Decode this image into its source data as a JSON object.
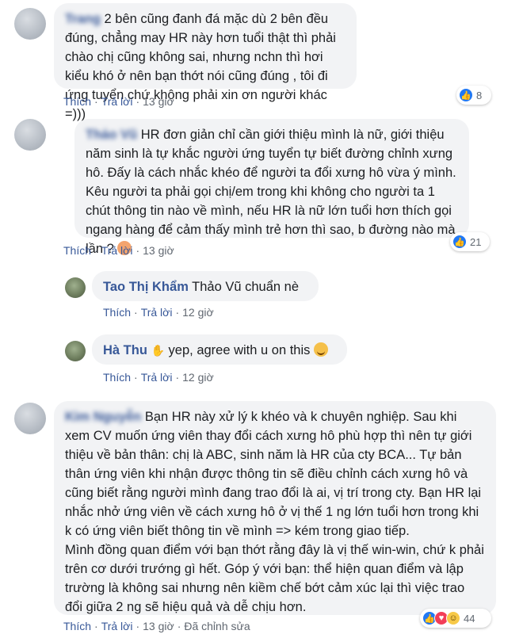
{
  "comments": [
    {
      "author": "Trang",
      "text": "2 bên cũng đanh đá mặc dù 2 bên đều đúng, chẳng may HR này hơn tuổi thật thì phải chào chị cũng không sai, nhưng nchn thì hơi kiểu khó ở nên bạn thớt nói cũng đúng , tôi đi ứng tuyển chứ không phải xin ơn người khác =)))",
      "actions": {
        "like": "Thích",
        "reply": "Trả lời",
        "time": "13 giờ"
      },
      "reaction_count": "8"
    },
    {
      "author": "Thảo Vũ",
      "text": "HR đơn giản chỉ cần giới thiệu mình là nữ, giới thiệu năm sinh là tự khắc người ứng tuyển tự biết đường chỉnh xưng hô. Đấy là cách nhắc khéo để người ta đổi xưng hô vừa ý mình. Kêu người ta phải gọi chị/em trong khi không cho người ta 1 chút thông tin nào về mình, nếu HR là nữ lớn tuổi hơn thích gọi ngang hàng để cảm thấy mình trẻ hơn thì sao, b đường nào mà lần ?",
      "actions": {
        "like": "Thích",
        "reply": "Trả lời",
        "time": "13 giờ"
      },
      "reaction_count": "21"
    },
    {
      "author": "Tao Thị Khẩm",
      "text": "Thảo Vũ chuẩn nè",
      "actions": {
        "like": "Thích",
        "reply": "Trả lời",
        "time": "12 giờ"
      }
    },
    {
      "author": "Hà Thu",
      "text": "yep, agree with u on this",
      "actions": {
        "like": "Thích",
        "reply": "Trả lời",
        "time": "12 giờ"
      }
    },
    {
      "author": "Kim Nguyễn",
      "text": "Bạn HR này xử lý k khéo và k chuyên nghiệp. Sau khi xem CV muốn ứng viên thay đổi cách xưng hô phù hợp thì nên tự giới thiệu về bản thân: chị là ABC, sinh năm là HR của cty BCA... Tự bản thân ứng viên khi nhận được thông tin sẽ điều chỉnh cách xưng hô và cũng biết rằng người mình đang trao đổi là ai, vị trí trong cty. Bạn HR lại nhắc nhở ứng viên về cách xưng hô ở vị thế 1 ng lớn tuổi hơn trong khi k có ứng viên biết thông tin về mình => kém trong giao tiếp.\nMình đồng quan điểm với bạn thớt rằng đây là vị thế win-win, chứ k phải trên cơ dưới trướng gì hết. Góp ý với bạn: thể hiện quan điểm và lập trường là không sai nhưng nên kiềm chế bớt cảm xúc lại thì việc trao đổi giữa 2 ng sẽ hiệu quả và dễ chịu hơn.",
      "actions": {
        "like": "Thích",
        "reply": "Trả lời",
        "time": "13 giờ",
        "edited": "Đã chỉnh sửa"
      },
      "reaction_count": "44"
    }
  ],
  "colors": {
    "link": "#385898",
    "bubble": "#f2f3f5",
    "meta": "#606770",
    "like": "#2078f4",
    "love": "#f33e58"
  }
}
